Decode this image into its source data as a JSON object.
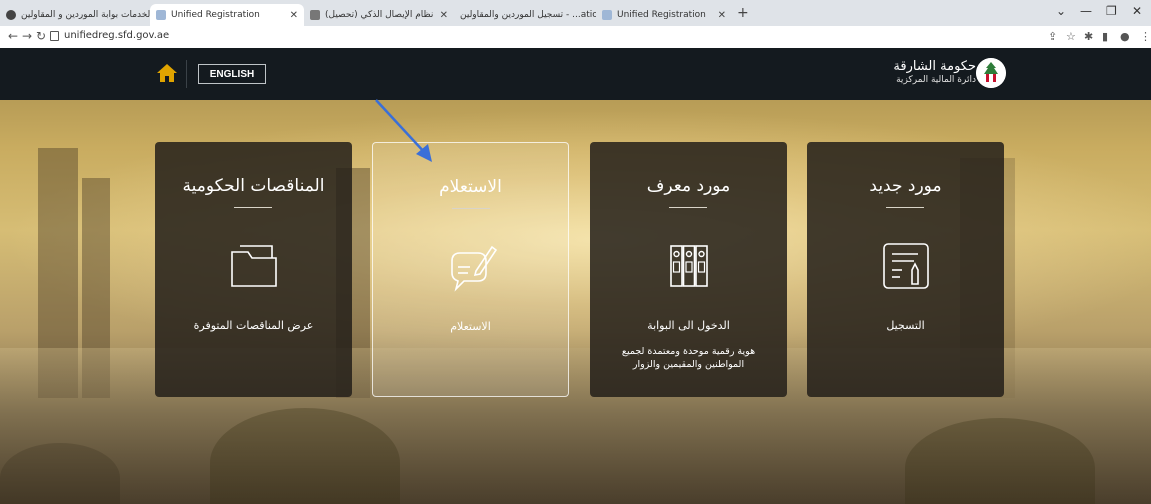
{
  "browser": {
    "tabs": [
      {
        "label": "الخدمات بوابة الموردين و المقاولين",
        "active": false
      },
      {
        "label": "Unified Registration",
        "active": true
      },
      {
        "label": "نظام الإيصال الذكي (تحصيل)",
        "active": false
      },
      {
        "label": "تسجيل الموردين والمقاولين - ...ation",
        "active": false
      },
      {
        "label": "Unified Registration",
        "active": false
      }
    ],
    "url": "unifiedreg.sfd.gov.ae"
  },
  "header": {
    "language_button": "ENGLISH",
    "logo_title": "حكومة الشارقة",
    "logo_subtitle": "دائرة المالية المركزية"
  },
  "cards": [
    {
      "title": "المناقصات الحكومية",
      "link": "عرض المناقصات المتوفرة",
      "desc": "",
      "icon": "folder-icon"
    },
    {
      "title": "الاستعلام",
      "link": "الاستعلام",
      "desc": "",
      "icon": "inquiry-chat-icon"
    },
    {
      "title": "مورد معرف",
      "link": "الدخول الى البوابة",
      "desc": "هوية رقمية موحدة ومعتمدة لجميع المواطنين والمقيمين والزوار",
      "icon": "binders-icon"
    },
    {
      "title": "مورد جديد",
      "link": "التسجيل",
      "desc": "",
      "icon": "registration-form-icon"
    }
  ],
  "colors": {
    "header_bg": "#141a1f",
    "card_bg": "#24201a",
    "accent_arrow": "#3a6fd8",
    "home_icon": "#e0a400"
  }
}
